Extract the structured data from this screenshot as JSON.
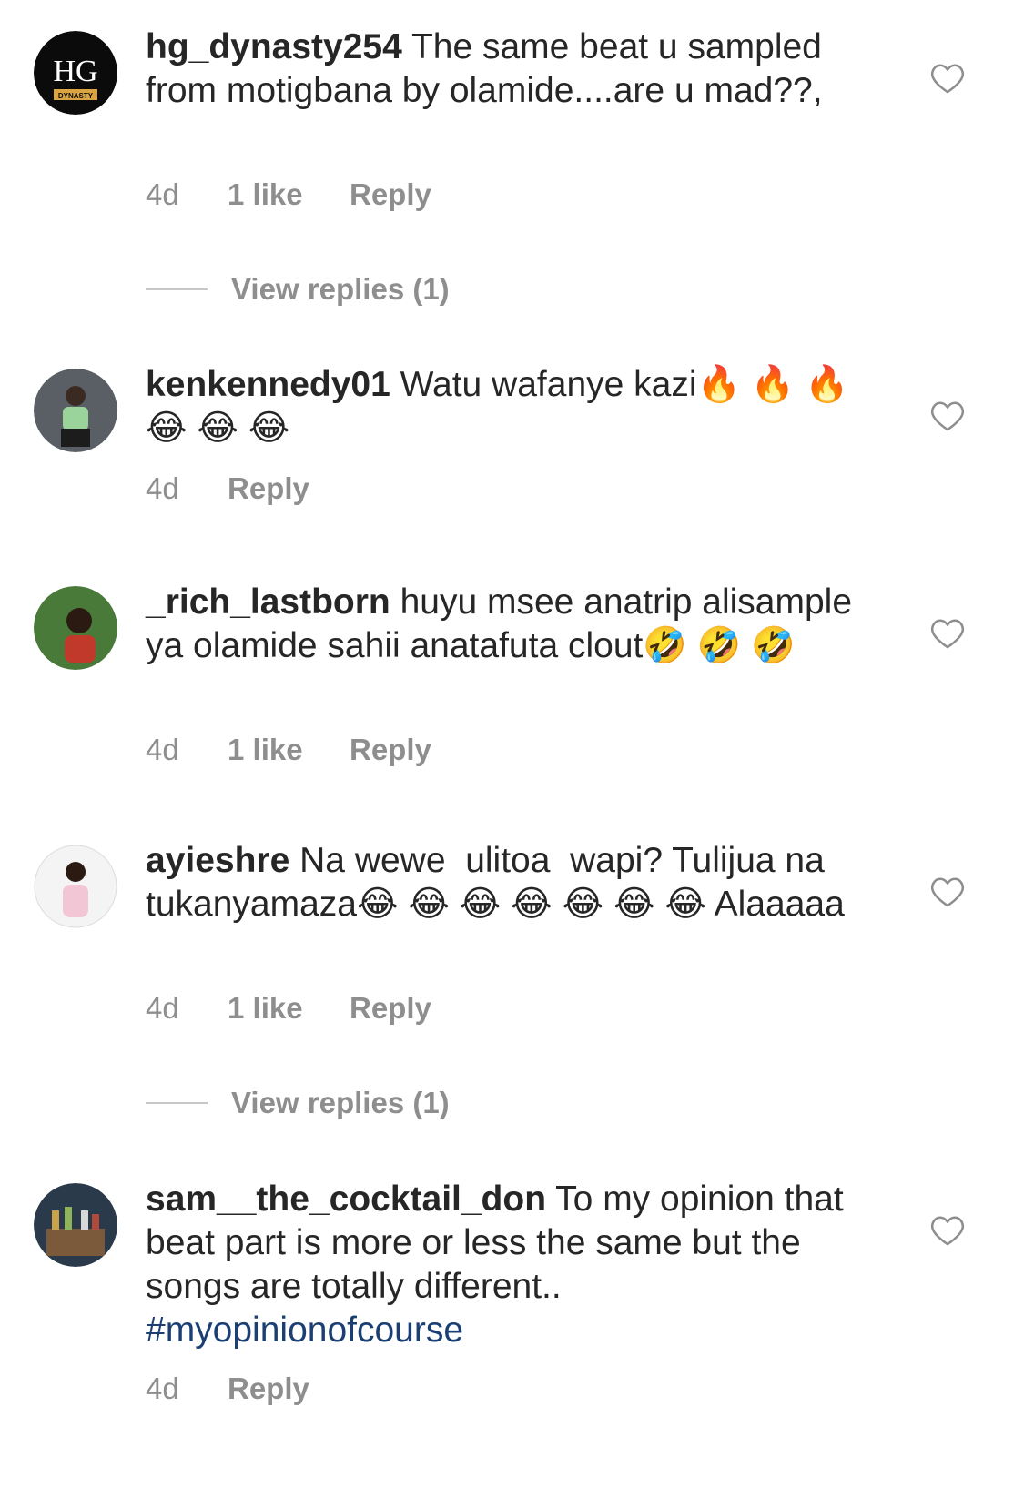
{
  "comments": [
    {
      "username": "hg_dynasty254",
      "text": " The same beat u sampled from motigbana by olamide....are u mad??,",
      "time": "4d",
      "likes": "1 like",
      "reply": "Reply",
      "avatar_logo_text": "HG",
      "avatar_logo_sub": "DYNASTY",
      "view_replies": "View replies (1)"
    },
    {
      "username": "kenkennedy01",
      "text": " Watu wafanye kazi🔥 🔥 🔥 😂 😂 😂",
      "time": "4d",
      "reply": "Reply"
    },
    {
      "username": "_rich_lastborn",
      "text": " huyu msee anatrip alisample ya olamide sahii anatafuta clout🤣 🤣 🤣",
      "time": "4d",
      "likes": "1 like",
      "reply": "Reply"
    },
    {
      "username": "ayieshre",
      "text": " Na wewe  ulitoa  wapi? Tulijua na  tukanyamaza😂 😂 😂 😂 😂 😂 😂 Alaaaaa",
      "time": "4d",
      "likes": "1 like",
      "reply": "Reply",
      "view_replies": "View replies (1)"
    },
    {
      "username": "sam__the_cocktail_don",
      "text": " To my opinion that beat part is more or less the same but the songs are totally different.. ",
      "hashtag": "#myopinionofcourse",
      "time": "4d",
      "reply": "Reply"
    }
  ],
  "colors": {
    "text": "#262626",
    "meta": "#8e8e8e",
    "hashtag": "#1b3f72",
    "divider": "#c7c7c7"
  },
  "icons": {
    "like": "heart-outline-icon"
  }
}
